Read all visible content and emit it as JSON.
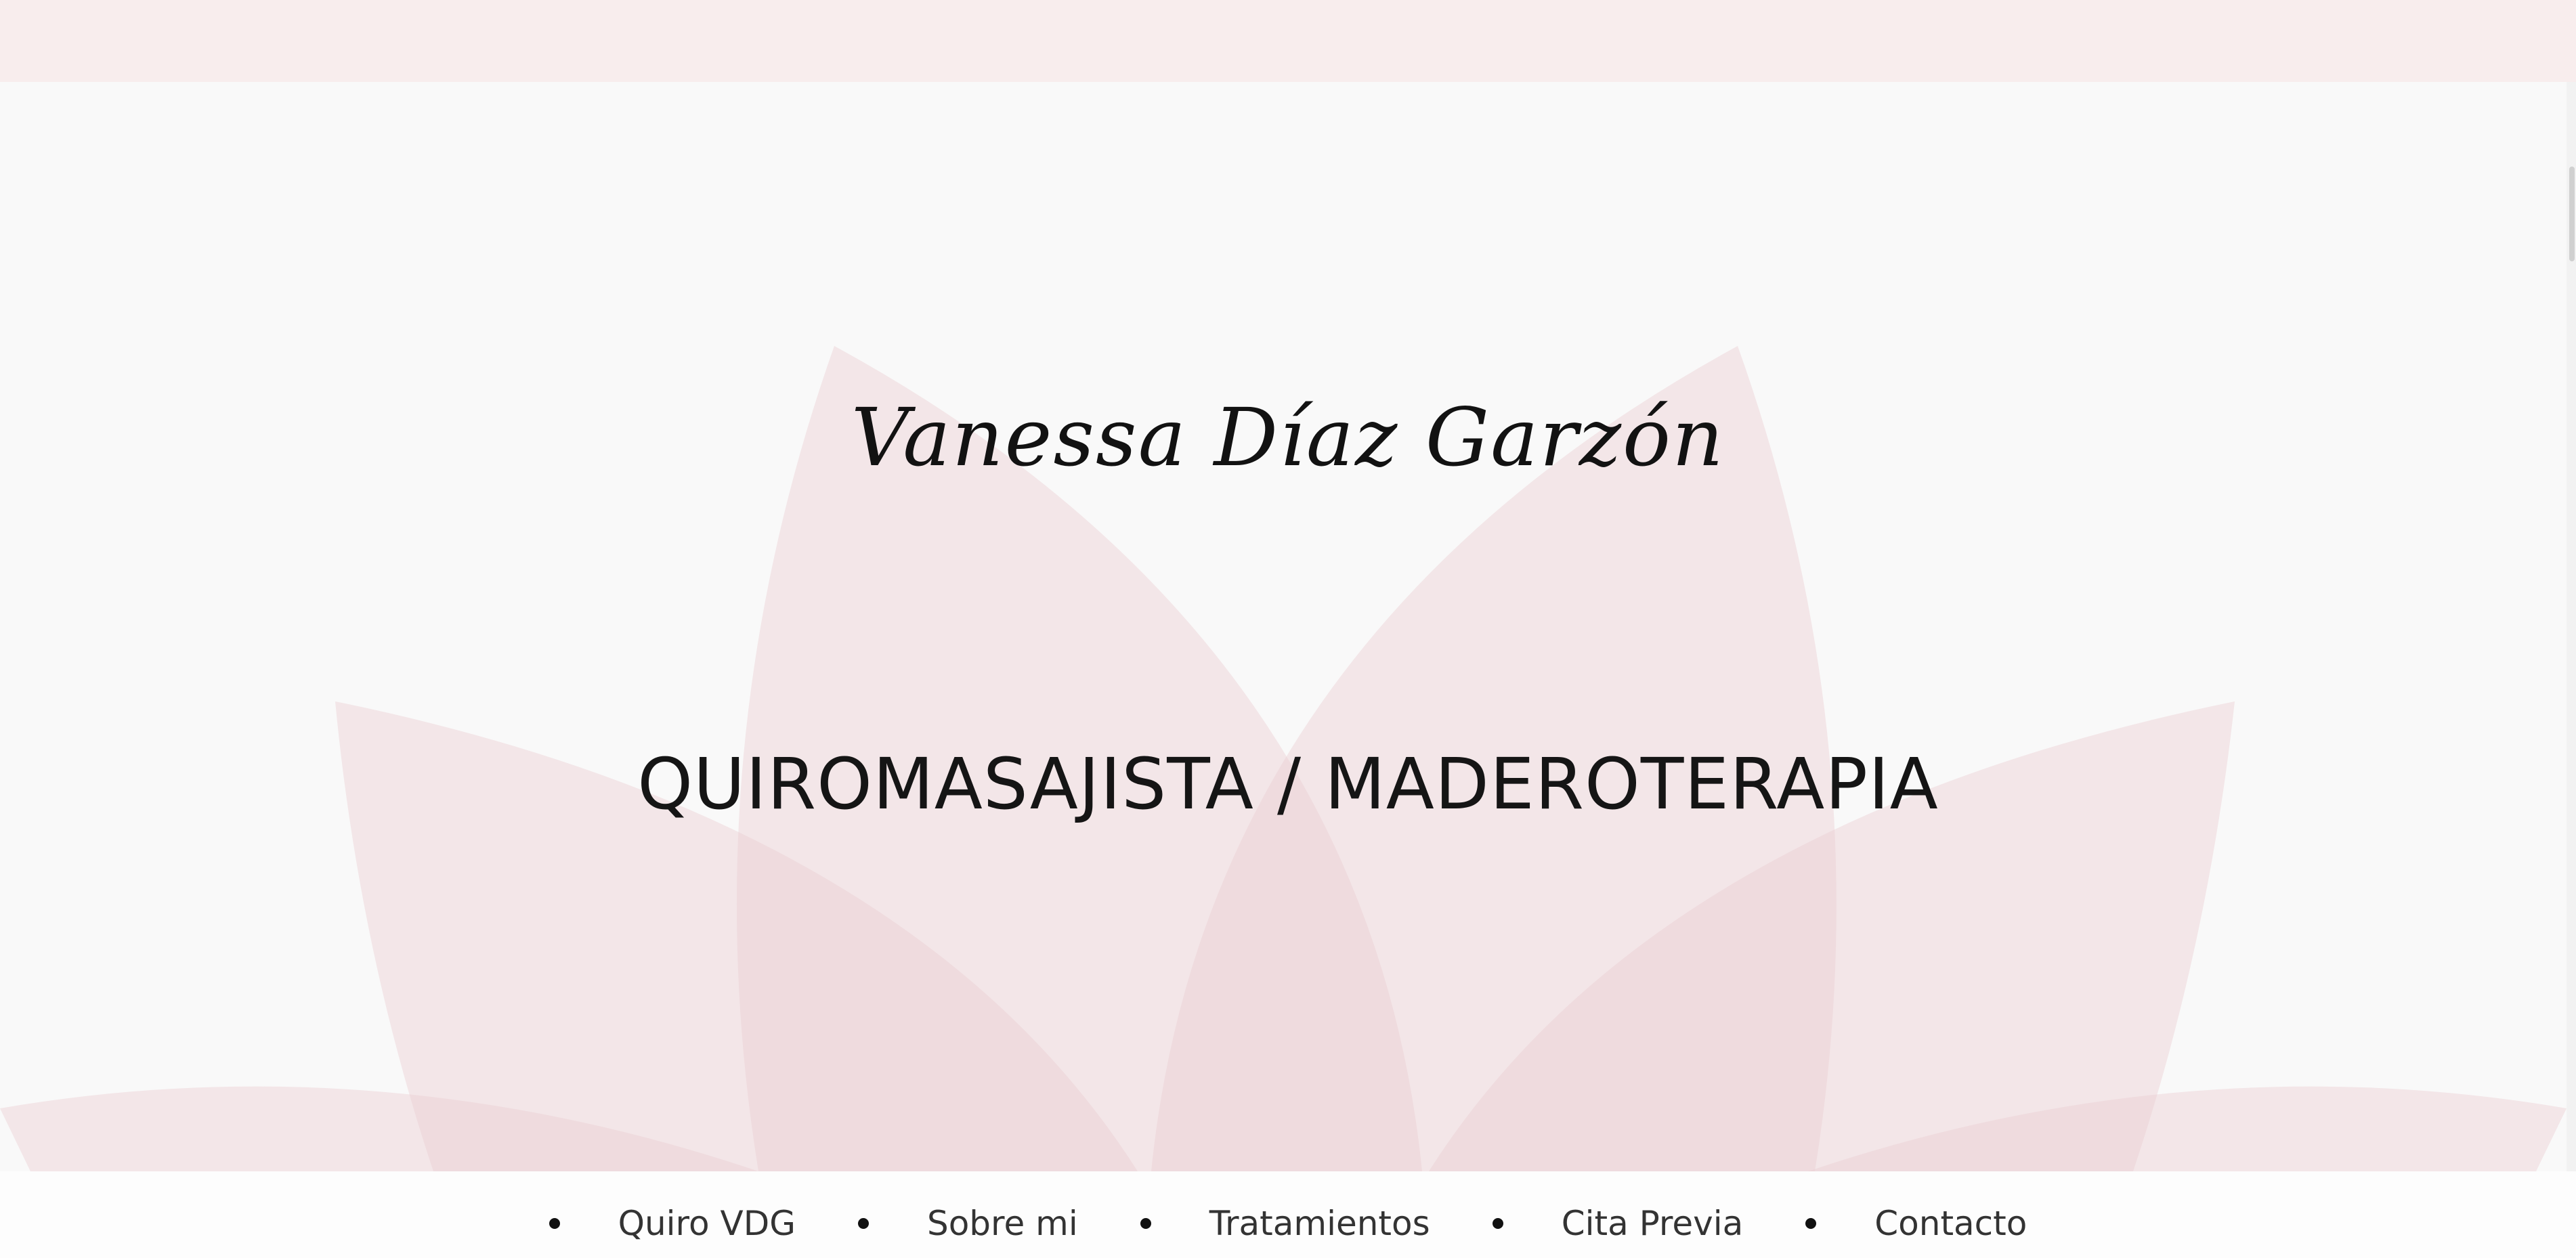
{
  "hero": {
    "title": "Vanessa Díaz Garzón",
    "subtitle": "QUIROMASAJISTA / MADEROTERAPIA",
    "petal_color": "#eccfd2"
  },
  "nav": {
    "items": [
      {
        "label": "Quiro VDG"
      },
      {
        "label": "Sobre mi"
      },
      {
        "label": "Tratamientos"
      },
      {
        "label": "Cita Previa"
      },
      {
        "label": "Contacto"
      }
    ]
  }
}
